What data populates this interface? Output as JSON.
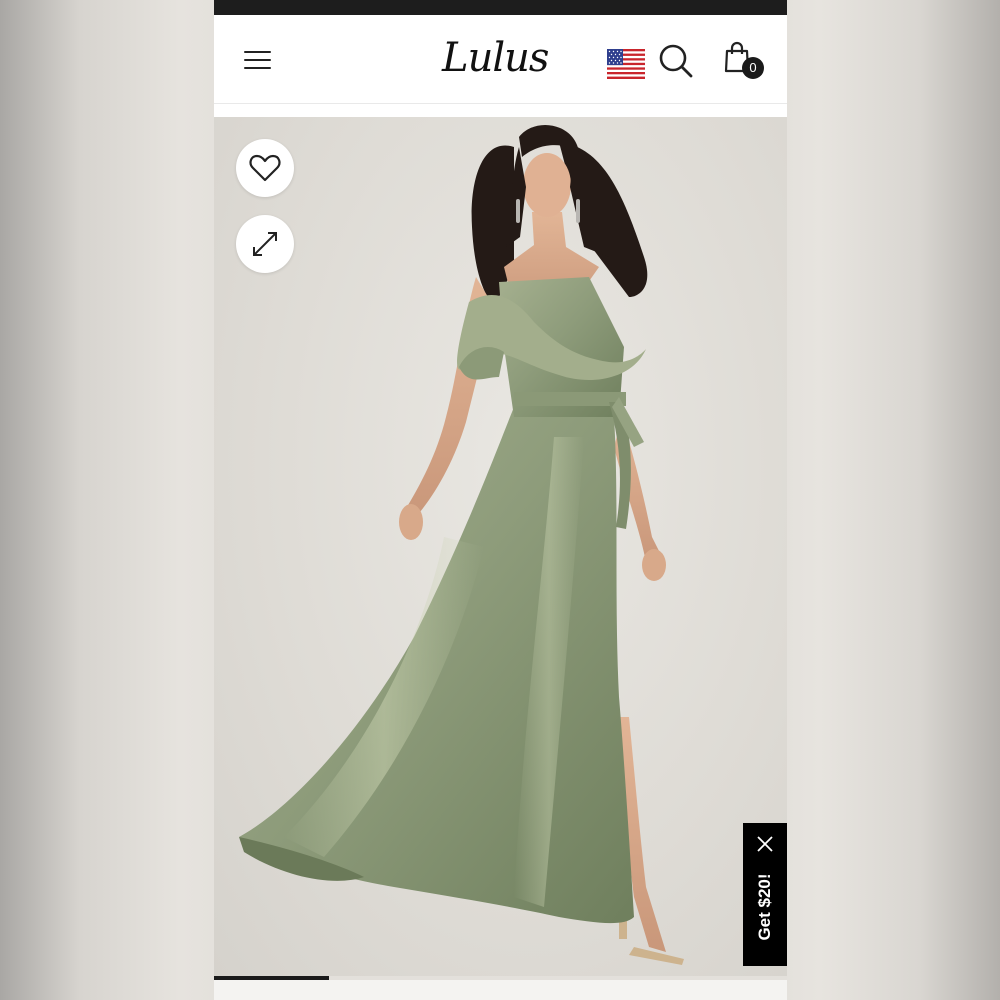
{
  "header": {
    "logo_text": "Lulus",
    "menu_icon": "hamburger-menu-icon",
    "flag_icon": "us-flag-icon",
    "search_icon": "search-icon",
    "cart_icon": "shopping-bag-icon",
    "cart_count": "0"
  },
  "gallery": {
    "actions": [
      "heart-icon",
      "expand-icon"
    ],
    "image_progress": 0.2
  },
  "promo": {
    "label": "Get $20!",
    "close_icon": "close-icon"
  },
  "colors": {
    "dress": "#8f9e7c",
    "background": "#e4e1dc",
    "promo_bg": "#000000"
  }
}
